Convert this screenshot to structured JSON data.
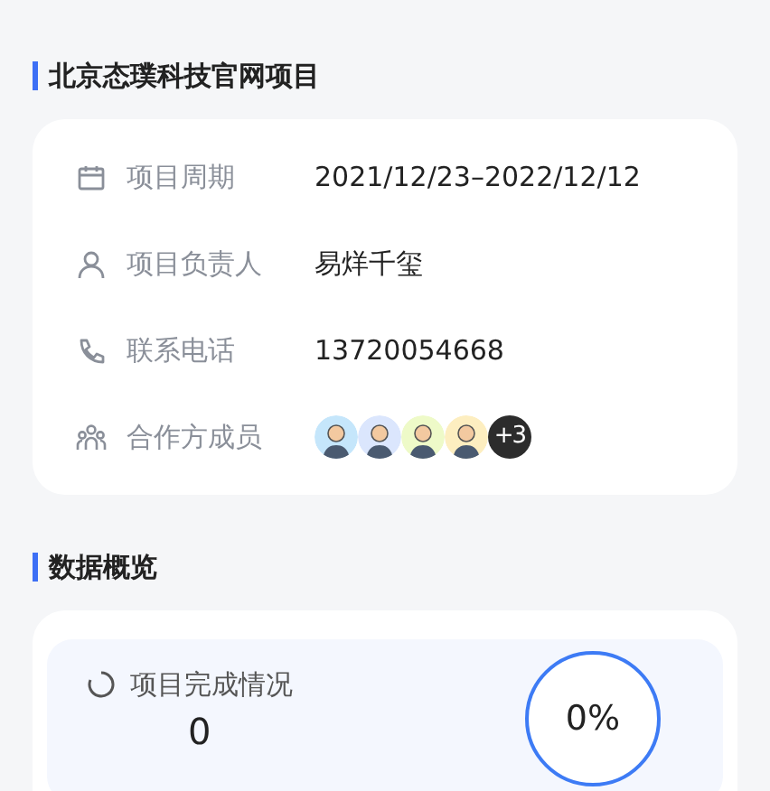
{
  "project": {
    "title": "北京态璞科技官网项目",
    "fields": [
      {
        "kind": "calendar",
        "label": "项目周期",
        "value": "2021/12/23–2022/12/12"
      },
      {
        "kind": "person",
        "label": "项目负责人",
        "value": "易烊千玺"
      },
      {
        "kind": "phone",
        "label": "联系电话",
        "value": "13720054668"
      },
      {
        "kind": "members",
        "label": "合作方成员",
        "avatars": [
          {
            "color": "#c5e6fb"
          },
          {
            "color": "#dbe6fd"
          },
          {
            "color": "#eefac8"
          },
          {
            "color": "#fdeec0"
          }
        ],
        "more": "+3"
      }
    ]
  },
  "overview": {
    "title": "数据概览",
    "panel": {
      "label": "项目完成情况",
      "count": "0",
      "percent": "0%",
      "level": 0
    }
  }
}
